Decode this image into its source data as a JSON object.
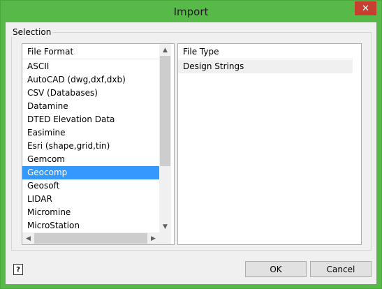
{
  "window": {
    "title": "Import",
    "close_glyph": "✕"
  },
  "selection": {
    "group_label": "Selection",
    "file_format": {
      "header": "File Format",
      "items": [
        "ASCII",
        "AutoCAD (dwg,dxf,dxb)",
        "CSV (Databases)",
        "Datamine",
        "DTED Elevation Data",
        "Easimine",
        "Esri (shape,grid,tin)",
        "Gemcom",
        "Geocomp",
        "Geosoft",
        "LIDAR",
        "Micromine",
        "MicroStation"
      ],
      "selected": "Geocomp"
    },
    "file_type": {
      "header": "File Type",
      "items": [
        "Design Strings"
      ]
    }
  },
  "footer": {
    "help_glyph": "?",
    "ok_label": "OK",
    "cancel_label": "Cancel"
  },
  "colors": {
    "title_bar": "#57b947",
    "close_button": "#c7402f",
    "selection": "#3399ff"
  }
}
